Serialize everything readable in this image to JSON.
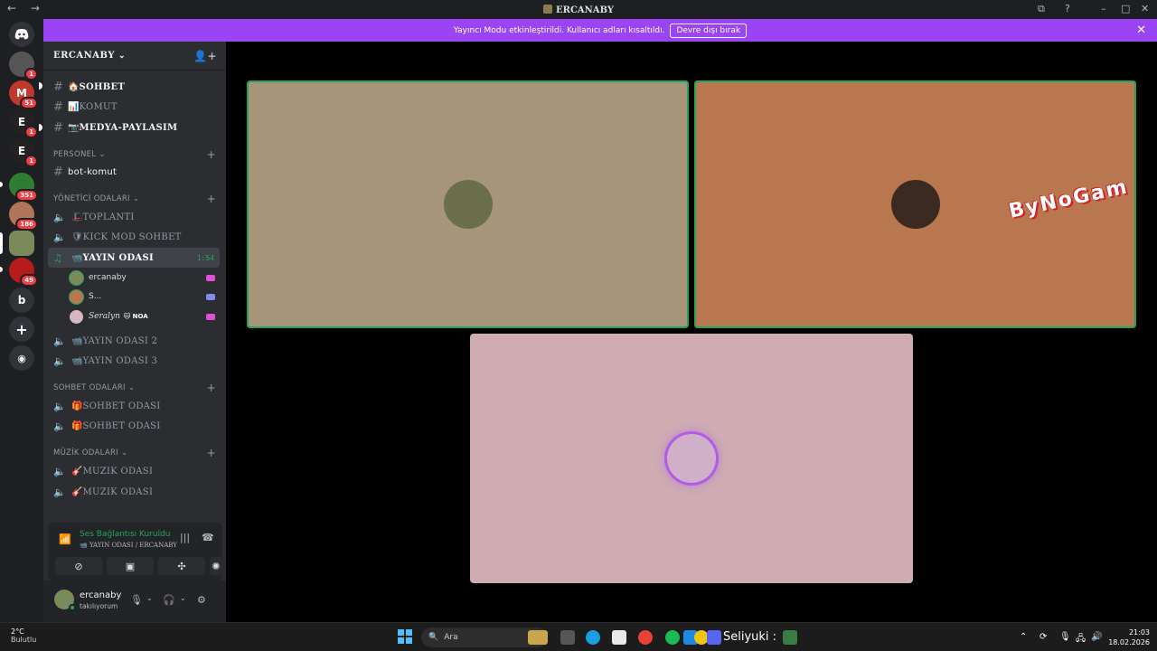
{
  "window": {
    "title": "ERCANABY",
    "nav": "← →",
    "controls": [
      "⧉",
      "?",
      "–",
      "□",
      "✕"
    ]
  },
  "banner": {
    "text": "Yayıncı Modu etkinleştirildi. Kullanıcı adları kısaltıldı.",
    "button": "Devre dışı bırak",
    "close": "✕"
  },
  "guilds": [
    {
      "label": "",
      "badge": "",
      "color": "#5865f2"
    },
    {
      "label": "",
      "badge": "1",
      "color": "#555"
    },
    {
      "label": "M",
      "badge": "51",
      "color": "#c0392b"
    },
    {
      "label": "E",
      "badge": "1",
      "color": "#222"
    },
    {
      "label": "E",
      "badge": "1",
      "color": "#222"
    },
    {
      "label": "",
      "badge": "351",
      "color": "#2e7d32"
    },
    {
      "label": "",
      "badge": "186",
      "color": "#b0755a"
    },
    {
      "label": "",
      "badge": "",
      "color": "#7a8a5a"
    },
    {
      "label": "",
      "badge": "49",
      "color": "#b71c1c"
    },
    {
      "label": "b",
      "badge": "",
      "color": "#313338"
    },
    {
      "label": "+",
      "badge": "",
      "color": "#313338"
    },
    {
      "label": "◉",
      "badge": "",
      "color": "#313338"
    }
  ],
  "server": {
    "name": "ERCANABY",
    "chevron": "⌄",
    "invite_icon": "👤+"
  },
  "channels": {
    "text_top": [
      {
        "emoji": "🏠",
        "name": "SOHBET"
      },
      {
        "emoji": "📊",
        "name": "KOMUT"
      },
      {
        "emoji": "📷",
        "name": "MEDYA-PAYLASIM"
      }
    ],
    "personel": {
      "label": "PERSONEL",
      "items": [
        {
          "name": "bot-komut"
        }
      ]
    },
    "yonetici": {
      "label": "YÖNETİCİ ODALARI",
      "items": [
        {
          "emoji": "🎩",
          "name": "TOPLANTI"
        },
        {
          "emoji": "🛡",
          "name": "KICK MOD SOHBET"
        },
        {
          "emoji": "📹",
          "name": "YAYIN ODASI",
          "time": "1:54"
        }
      ],
      "voice_users": [
        {
          "name": "ercanaby",
          "tag": ""
        },
        {
          "name": "S...",
          "tag": ""
        },
        {
          "name": "Seralyn",
          "tag": "🐱 NOA"
        }
      ],
      "more": [
        {
          "emoji": "📹",
          "name": "YAYIN ODASI 2"
        },
        {
          "emoji": "📹",
          "name": "YAYIN ODASI 3"
        }
      ]
    },
    "sohbet": {
      "label": "SOHBET ODALARI",
      "items": [
        {
          "emoji": "🎁",
          "name": "SOHBET ODASI"
        },
        {
          "emoji": "🎁",
          "name": "SOHBET ODASI"
        }
      ]
    },
    "muzik": {
      "label": "MÜZİK ODALARI",
      "items": [
        {
          "emoji": "🎸",
          "name": "MUZIK ODASI"
        },
        {
          "emoji": "🎸",
          "name": "MUZIK ODASI"
        }
      ]
    }
  },
  "voice_panel": {
    "status": "Ses Bağlantısı Kuruldu",
    "location": "📹 YAYIN ODASI / ERCANABY"
  },
  "user": {
    "name": "ercanaby",
    "status": "takılıyorum"
  },
  "tiles": [
    {
      "color": "#a6957a",
      "avatar_color": "#6a6f4a"
    },
    {
      "color": "#b8774e",
      "avatar_color": "#3b2a22"
    },
    {
      "color": "#ceacb2",
      "avatar_color": "#d0b0c8"
    }
  ],
  "overlay": {
    "text": "ByNoGam"
  },
  "taskbar": {
    "weather": {
      "temp": "2°C",
      "loc": "Bulutlu"
    },
    "search": "Ara",
    "now_playing": "Seliyuki :",
    "time": "21:03",
    "date": "18.02.2026"
  }
}
